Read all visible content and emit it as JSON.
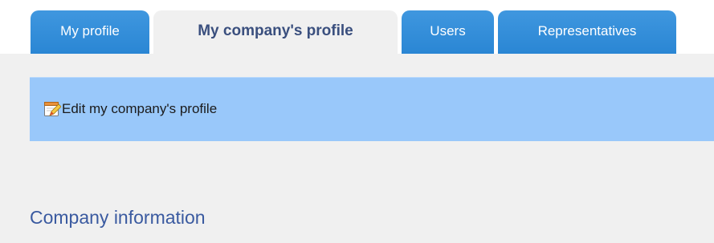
{
  "tabs": [
    {
      "label": "My profile",
      "active": false
    },
    {
      "label": "My company's profile",
      "active": true
    },
    {
      "label": "Users",
      "active": false
    },
    {
      "label": "Representatives",
      "active": false
    }
  ],
  "actions": {
    "edit_label": "Edit my company's profile",
    "edit_icon": "edit-profile-icon"
  },
  "section": {
    "title": "Company information"
  },
  "colors": {
    "tab_blue": "#2a86d4",
    "active_tab_bg": "#f0f0f0",
    "action_bar_bg": "#99c8fa",
    "heading_color": "#3a5aa0"
  }
}
